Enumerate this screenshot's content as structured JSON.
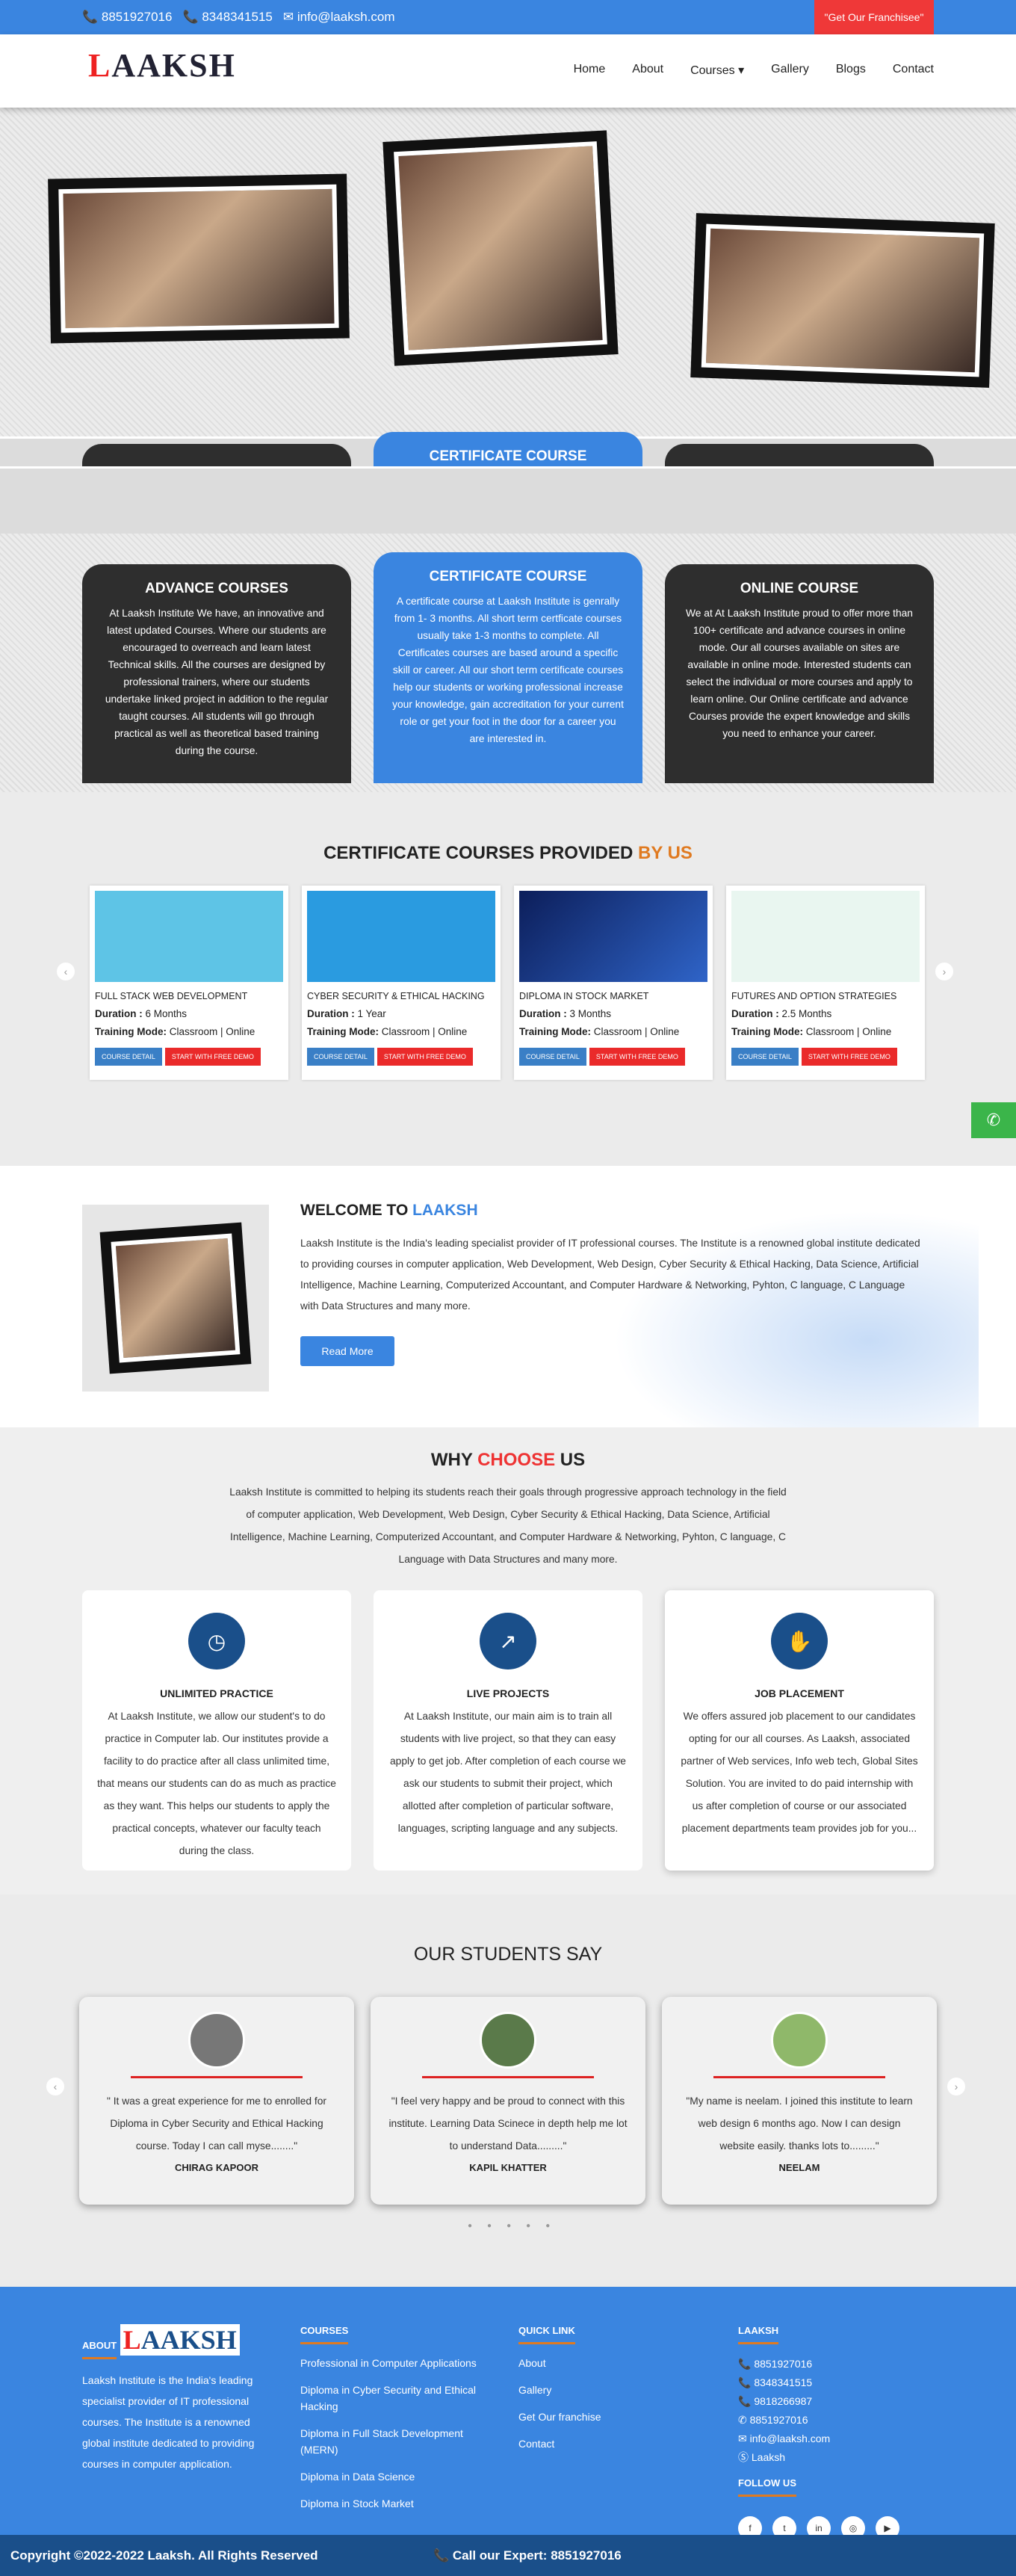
{
  "topbar": {
    "phone1": "📞 8851927016",
    "phone2": "📞 8348341515",
    "email": "✉ info@laaksh.com",
    "franchise": "\"Get Our Franchisee\""
  },
  "nav": {
    "logo_a": "L",
    "logo_b": "AAKSH",
    "items": [
      "Home",
      "About",
      "Courses ▾",
      "Gallery",
      "Blogs",
      "Contact"
    ]
  },
  "hero": {
    "peek_title": "CERTIFICATE COURSE"
  },
  "cards": [
    {
      "title": "ADVANCE COURSES",
      "text": "At Laaksh Institute We have, an innovative and latest updated Courses. Where our students are encouraged to overreach and learn latest Technical skills. All the courses are designed by professional trainers, where our students undertake linked project in addition to the regular taught courses. All students will go through practical as well as theoretical based training during the course."
    },
    {
      "title": "CERTIFICATE COURSE",
      "text": "A certificate course at Laaksh Institute is genrally from 1- 3 months. All short term certficate courses usually take 1-3 months to complete. All Certificates courses are based around a specific skill or career. All our short term certificate courses help our students or working professional increase your knowledge, gain accreditation for your current role or get your foot in the door for a career you are interested in."
    },
    {
      "title": "ONLINE COURSE",
      "text": "We at At Laaksh Institute proud to offer more than 100+ certificate and advance courses in online mode. Our all courses available on sites are available in online mode. Interested students can select the individual or more courses and apply to learn online. Our Online certificate and advance Courses provide the expert knowledge and skills you need to enhance your career."
    }
  ],
  "courses_sec": {
    "title_a": "CERTIFICATE COURSES PROVIDED ",
    "title_b": "BY US",
    "dur_label": "Duration :",
    "mode_label": "Training Mode:",
    "detail": "COURSE DETAIL",
    "demo": "START WITH FREE DEMO",
    "items": [
      {
        "name": "FULL STACK WEB DEVELOPMENT",
        "duration": " 6 Months",
        "mode": " Classroom | Online"
      },
      {
        "name": "CYBER SECURITY & ETHICAL HACKING",
        "duration": " 1 Year",
        "mode": " Classroom | Online"
      },
      {
        "name": "DIPLOMA IN STOCK MARKET",
        "duration": " 3 Months",
        "mode": " Classroom | Online"
      },
      {
        "name": "FUTURES AND OPTION STRATEGIES",
        "duration": " 2.5 Months",
        "mode": " Classroom | Online"
      }
    ]
  },
  "welcome": {
    "title_a": "WELCOME TO ",
    "title_b": "LAAKSH",
    "text": "Laaksh Institute is the India's leading specialist provider of IT professional courses. The Institute is a renowned global institute dedicated to providing courses in computer application, Web Development, Web Design, Cyber Security & Ethical Hacking, Data Science, Artificial Intelligence, Machine Learning, Computerized Accountant, and Computer Hardware & Networking, Pyhton, C language, C Language with Data Structures and many more.",
    "button": "Read More"
  },
  "why": {
    "title_a": "WHY ",
    "title_b": "CHOOSE",
    "title_c": " US",
    "text": "Laaksh Institute is committed to helping its students reach their goals through progressive approach technology in the field of computer application, Web Development, Web Design, Cyber Security & Ethical Hacking, Data Science, Artificial Intelligence, Machine Learning, Computerized Accountant, and Computer Hardware & Networking, Pyhton, C language, C Language with Data Structures and many more.",
    "items": [
      {
        "title": "UNLIMITED PRACTICE",
        "text": "At Laaksh Institute, we allow our student's to do practice in Computer lab. Our institutes provide a facility to do practice after all class unlimited time, that means our students can do as much as practice as they want. This helps our students to apply the practical concepts, whatever our faculty teach during the class."
      },
      {
        "title": "LIVE PROJECTS",
        "text": "At Laaksh Institute, our main aim is to train all students with live project, so that they can easy apply to get job. After completion of each course we ask our students to submit their project, which allotted after completion of particular software, languages, scripting language and any subjects."
      },
      {
        "title": "JOB PLACEMENT",
        "text": "We offers assured job placement to our candidates opting for our all courses. As Laaksh, associated partner of Web services, Info web tech, Global Sites Solution. You are invited to do paid internship with us after completion of course or our associated placement departments team provides job for you..."
      }
    ]
  },
  "testimonials": {
    "title": "OUR STUDENTS SAY",
    "items": [
      {
        "text": "\" It was a great experience for me to enrolled for Diploma in Cyber Security and Ethical Hacking course. Today I can call myse........\"",
        "name": "CHIRAG KAPOOR"
      },
      {
        "text": "\"I feel very happy and be proud to connect with this institute. Learning Data Scinece in depth help me lot to understand Data.........\"",
        "name": "KAPIL KHATTER"
      },
      {
        "text": "\"My name is neelam. I joined this institute to learn web design 6 months ago. Now I can design website easily. thanks lots to.........\"",
        "name": "NEELAM"
      }
    ]
  },
  "footer": {
    "about": {
      "head": "ABOUT",
      "text": "Laaksh Institute is the India's leading specialist provider of IT professional courses. The Institute is a renowned global institute dedicated to providing courses in computer application."
    },
    "courses": {
      "head": "COURSES",
      "items": [
        "Professional in Computer Applications",
        "Diploma in Cyber Security and Ethical Hacking",
        "Diploma in Full Stack Development (MERN)",
        "Diploma in Data Science",
        "Diploma in Stock Market"
      ]
    },
    "quick": {
      "head": "QUICK LINK",
      "items": [
        "About",
        "Gallery",
        "Get Our franchise",
        "Contact"
      ]
    },
    "laaksh": {
      "head": "LAAKSH",
      "items": [
        "📞  8851927016",
        "📞  8348341515",
        "📞  9818266987",
        "✆  8851927016",
        "✉  info@laaksh.com",
        "Ⓢ  Laaksh"
      ],
      "follow": "FOLLOW US",
      "social": [
        "f",
        "t",
        "in",
        "◎",
        "▶"
      ]
    }
  },
  "bottom": {
    "copyright": "Copyright ©2022-2022 Laaksh. All Rights Reserved",
    "expert": "📞  Call our Expert: 8851927016"
  }
}
